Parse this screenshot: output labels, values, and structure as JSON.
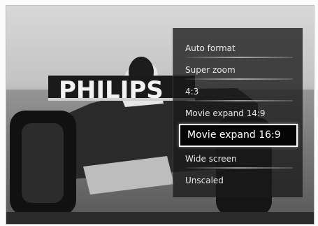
{
  "menu": {
    "items": [
      {
        "label": "Auto format",
        "selected": false
      },
      {
        "label": "Super zoom",
        "selected": false
      },
      {
        "label": "4:3",
        "selected": false
      },
      {
        "label": "Movie expand 14:9",
        "selected": false
      },
      {
        "label": "Movie expand 16:9",
        "selected": true
      },
      {
        "label": "Wide screen",
        "selected": false
      },
      {
        "label": "Unscaled",
        "selected": false
      }
    ]
  },
  "background": {
    "car_logo_text": "PHILIPS"
  }
}
